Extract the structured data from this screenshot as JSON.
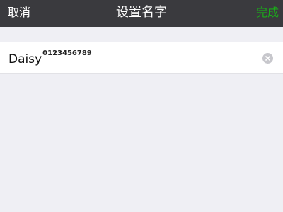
{
  "nav": {
    "cancel_label": "取消",
    "title": "设置名字",
    "done_label": "完成",
    "done_color": "#1aad19"
  },
  "name_field": {
    "value_main": "Daisy",
    "value_superscript": "0123456789",
    "clear_icon": "clear-circle-icon"
  }
}
